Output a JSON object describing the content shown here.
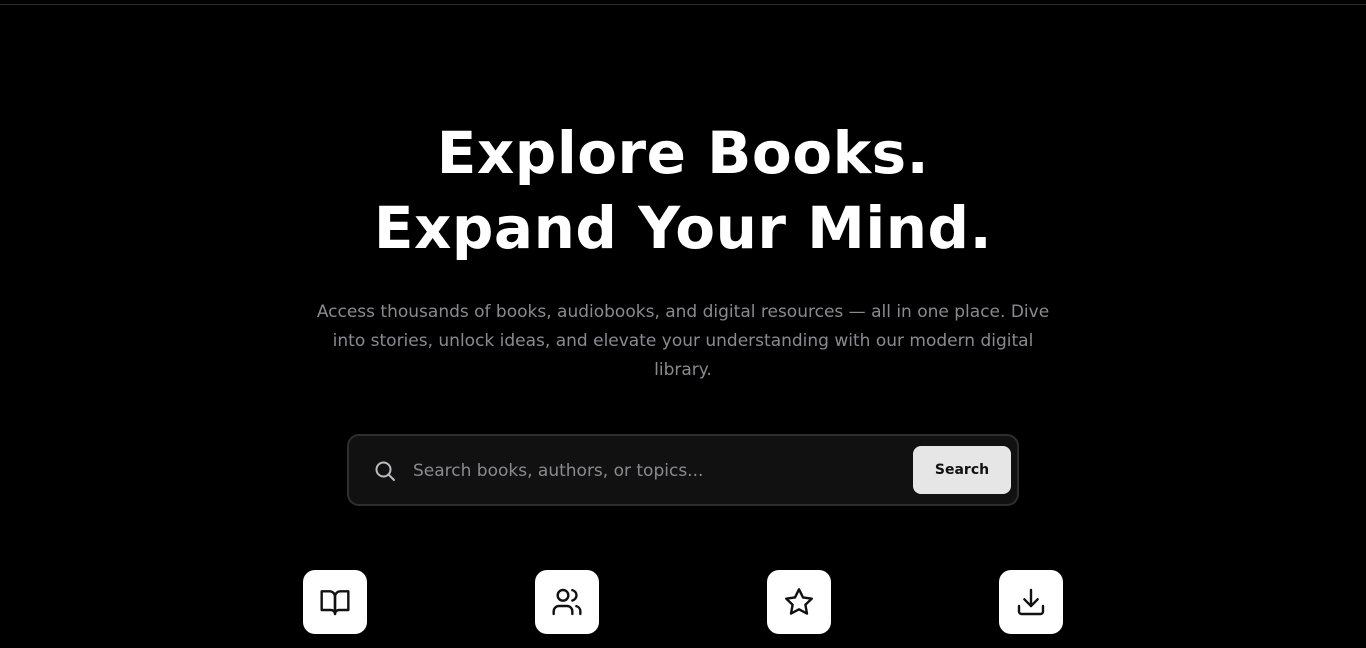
{
  "hero": {
    "headline_line1": "Explore Books.",
    "headline_line2": "Expand Your Mind.",
    "subtitle": "Access thousands of books, audiobooks, and digital resources — all in one place. Dive into stories, unlock ideas, and elevate your understanding with our modern digital library."
  },
  "search": {
    "placeholder": "Search books, authors, or topics...",
    "value": "",
    "button_label": "Search",
    "icon": "search-icon"
  },
  "features": [
    {
      "icon": "book-open-icon"
    },
    {
      "icon": "users-icon"
    },
    {
      "icon": "star-icon"
    },
    {
      "icon": "download-icon"
    }
  ],
  "colors": {
    "background": "#000000",
    "headline": "#ffffff",
    "subtitle": "#8a8a8f",
    "search_bg": "#111111",
    "search_border": "#2e2e2e",
    "button_bg": "#e6e6e6",
    "icon_tile_bg": "#ffffff"
  }
}
